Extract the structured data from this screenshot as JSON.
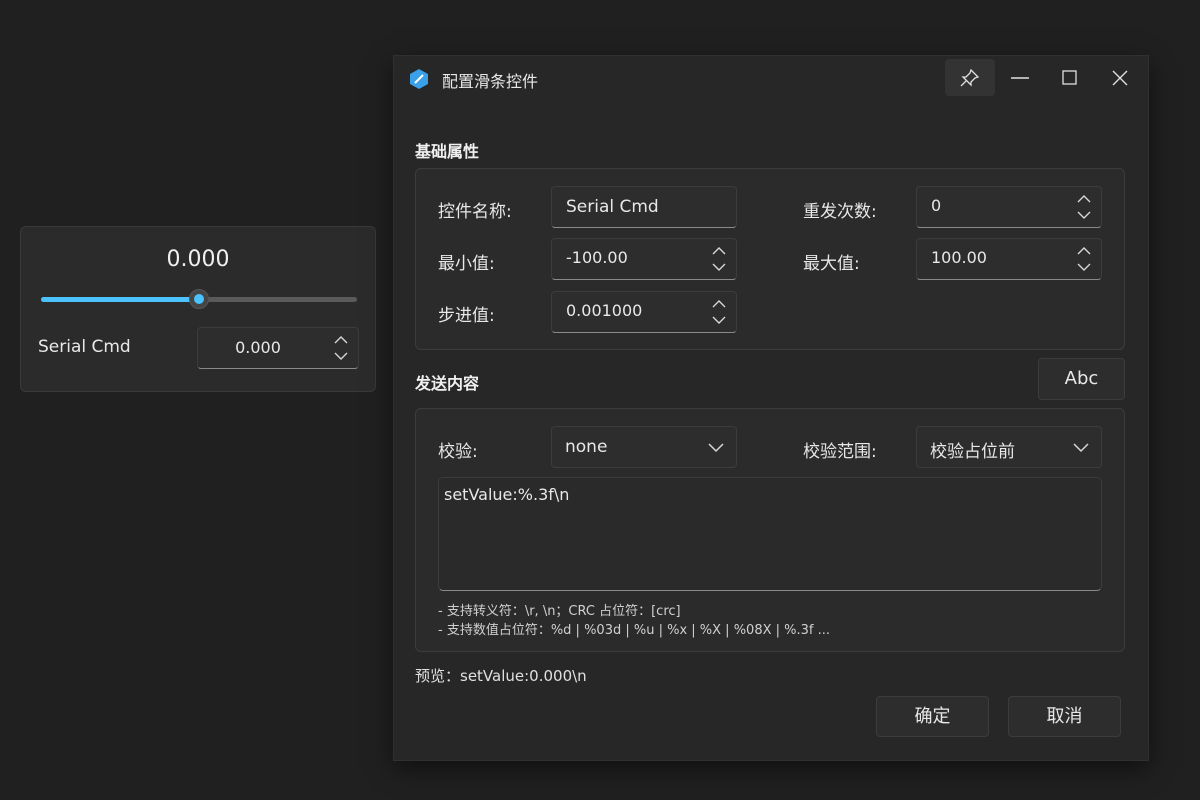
{
  "widget": {
    "value_display": "0.000",
    "slider_level_percent": 50,
    "name": "Serial Cmd",
    "spin_value": "0.000"
  },
  "dialog": {
    "title": "配置滑条控件",
    "basic": {
      "section_title": "基础属性",
      "name_label": "控件名称:",
      "name_value": "Serial Cmd",
      "repeat_label": "重发次数:",
      "repeat_value": "0",
      "min_label": "最小值:",
      "min_value": "-100.00",
      "max_label": "最大值:",
      "max_value": "100.00",
      "step_label": "步进值:",
      "step_value": "0.001000"
    },
    "send": {
      "section_title": "发送内容",
      "abc_button": "Abc",
      "checksum_label": "校验:",
      "checksum_value": "none",
      "range_label": "校验范围:",
      "range_value": "校验占位前",
      "content": "setValue:%.3f\\n",
      "hint1": "- 支持转义符：\\r, \\n；CRC 占位符：[crc]",
      "hint2": "- 支持数值占位符：%d | %03d | %u | %x | %X | %08X | %.3f ..."
    },
    "preview": "预览：setValue:0.000\\n",
    "ok_button": "确定",
    "cancel_button": "取消"
  },
  "colors": {
    "accent": "#4cc2ff",
    "background": "#202020",
    "panel": "#2b2b2b"
  },
  "icons": [
    "app-logo-icon",
    "pin-icon",
    "minimize-icon",
    "maximize-icon",
    "close-icon",
    "spin-up-down-icon",
    "chevron-down-icon"
  ]
}
